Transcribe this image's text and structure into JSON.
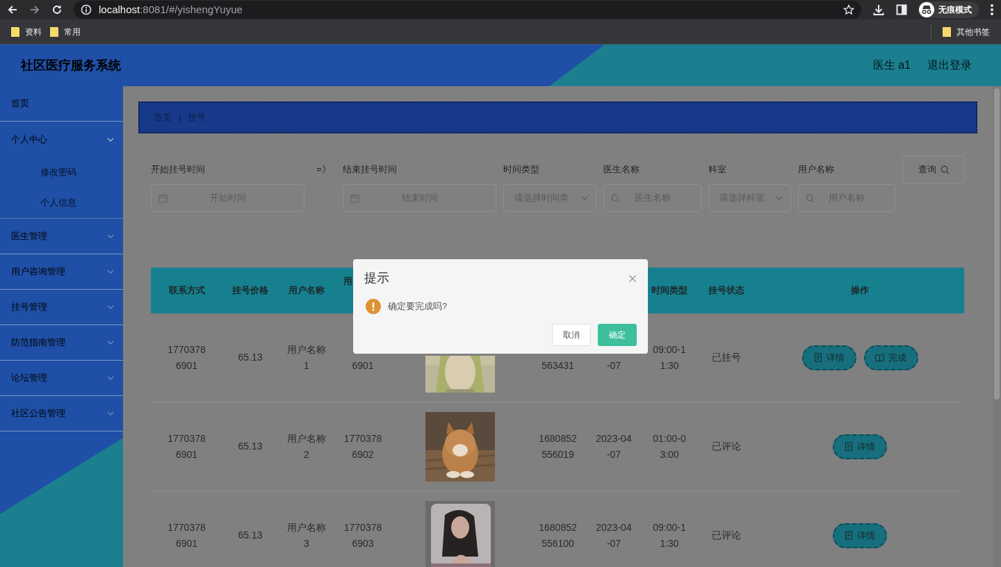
{
  "browser": {
    "url_host": "localhost",
    "url_path": ":8081/#/yishengYuyue",
    "profile": "无痕模式",
    "bookmarks": [
      "资料",
      "常用"
    ],
    "other_bookmarks": "其他书签"
  },
  "app": {
    "title": "社区医疗服务系统",
    "user": "医生 a1",
    "logout": "退出登录"
  },
  "sidebar": {
    "items": [
      {
        "label": "首页",
        "expandable": false
      },
      {
        "label": "个人中心",
        "expandable": true,
        "expanded": true,
        "children": [
          {
            "label": "修改密码"
          },
          {
            "label": "个人信息"
          }
        ]
      },
      {
        "label": "医生管理",
        "expandable": true,
        "expanded": false
      },
      {
        "label": "用户咨询管理",
        "expandable": true,
        "expanded": false
      },
      {
        "label": "挂号管理",
        "expandable": true,
        "expanded": false
      },
      {
        "label": "防范指南管理",
        "expandable": true,
        "expanded": false
      },
      {
        "label": "论坛管理",
        "expandable": true,
        "expanded": false
      },
      {
        "label": "社区公告管理",
        "expandable": true,
        "expanded": false
      }
    ]
  },
  "breadcrumb": {
    "items": [
      "首页",
      "挂号"
    ],
    "separator": "|"
  },
  "filters": [
    {
      "kind": "date",
      "label": "开始挂号时间",
      "placeholder": "开始时间"
    },
    {
      "kind": "separator",
      "label": "=》"
    },
    {
      "kind": "date",
      "label": "结束挂号时间",
      "placeholder": "结束时间"
    },
    {
      "kind": "select",
      "label": "时间类型",
      "placeholder": "请选择时间类"
    },
    {
      "kind": "search",
      "label": "医生名称",
      "placeholder": "医生名称"
    },
    {
      "kind": "select",
      "label": "科室",
      "placeholder": "请选择科室"
    },
    {
      "kind": "search",
      "label": "用户名称",
      "placeholder": "用户名称"
    }
  ],
  "query_button": "查询",
  "table": {
    "columns": [
      "联系方式",
      "挂号价格",
      "用户名称",
      "用",
      "",
      "",
      "",
      "时间类型",
      "挂号状态",
      "操作"
    ],
    "rows": [
      {
        "cells": [
          "17703786901",
          "65.13",
          "用户名称1",
          {
            "text": "6901",
            "covered_top": true
          },
          {
            "kind": "picture",
            "covered_top": true
          },
          {
            "text": "563431",
            "covered_top": true
          },
          {
            "text": "-07",
            "covered_top": true
          },
          "09:00-11:30",
          "已挂号"
        ],
        "actions": [
          {
            "label": "详情",
            "kind": "detail"
          },
          {
            "label": "完成",
            "kind": "complete"
          }
        ]
      },
      {
        "cells": [
          "17703786901",
          "65.13",
          "用户名称2",
          "17703786902",
          {
            "kind": "picture",
            "covered_top": false
          },
          "1680852556019",
          "2023-04-07",
          "01:00-03:00",
          "已评论"
        ],
        "actions": [
          {
            "label": "详情",
            "kind": "detail"
          }
        ]
      },
      {
        "cells": [
          "17703786901",
          "65.13",
          "用户名称3",
          "17703786903",
          {
            "kind": "picture",
            "covered_top": false
          },
          "1680852556100",
          "2023-04-07",
          "09:00-11:30",
          "已评论"
        ],
        "actions": [
          {
            "label": "详情",
            "kind": "detail"
          }
        ]
      }
    ]
  },
  "dialog": {
    "title": "提示",
    "message": "确定要完成吗?",
    "buttons": [
      {
        "label": "取消",
        "kind": "secondary"
      },
      {
        "label": "确定",
        "kind": "primary"
      }
    ]
  }
}
